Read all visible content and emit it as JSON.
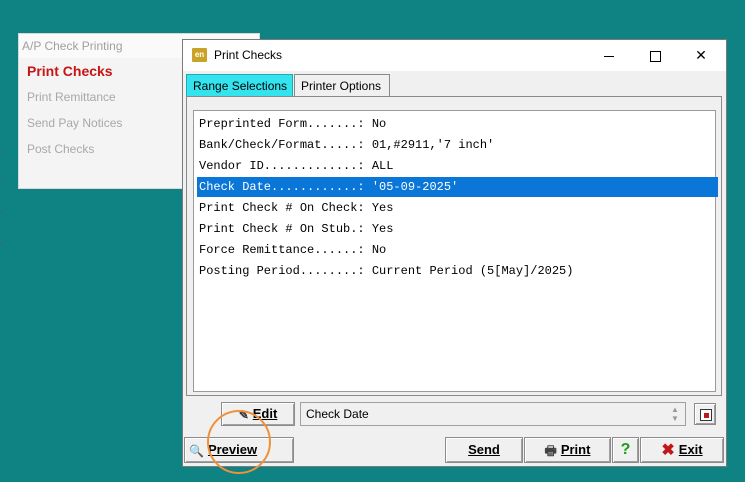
{
  "background_menu": {
    "title": "A/P Check Printing",
    "items": [
      {
        "label": "Print Checks",
        "active": true
      },
      {
        "label": "Print Remittance",
        "active": false
      },
      {
        "label": "Send Pay Notices",
        "active": false
      },
      {
        "label": "Post Checks",
        "active": false
      }
    ]
  },
  "dialog": {
    "icon_text": "en",
    "title": "Print Checks",
    "tabs": [
      {
        "label": "Range Selections",
        "active": true
      },
      {
        "label": "Printer Options",
        "active": false
      }
    ],
    "rows": [
      {
        "text": "Preprinted Form.......: No",
        "selected": false
      },
      {
        "text": "Bank/Check/Format.....: 01,#2911,'7 inch'",
        "selected": false
      },
      {
        "text": "Vendor ID.............: ALL",
        "selected": false
      },
      {
        "text": "Check Date............: '05-09-2025'",
        "selected": true
      },
      {
        "text": "Print Check # On Check: Yes",
        "selected": false
      },
      {
        "text": "Print Check # On Stub.: Yes",
        "selected": false
      },
      {
        "text": "Force Remittance......: No",
        "selected": false
      },
      {
        "text": "Posting Period........: Current Period (5[May]/2025)",
        "selected": false
      }
    ],
    "edit_label": "Edit",
    "current_field": "Check Date",
    "buttons": {
      "preview": "Preview",
      "send": "Send",
      "print": "Print",
      "help": "?",
      "exit": "Exit"
    }
  },
  "colors": {
    "desktop": "#0f8383",
    "selection": "#0a76d8",
    "active_tab": "#33e3ee",
    "menu_active": "#c81414",
    "highlight_circle": "#f0903a"
  }
}
